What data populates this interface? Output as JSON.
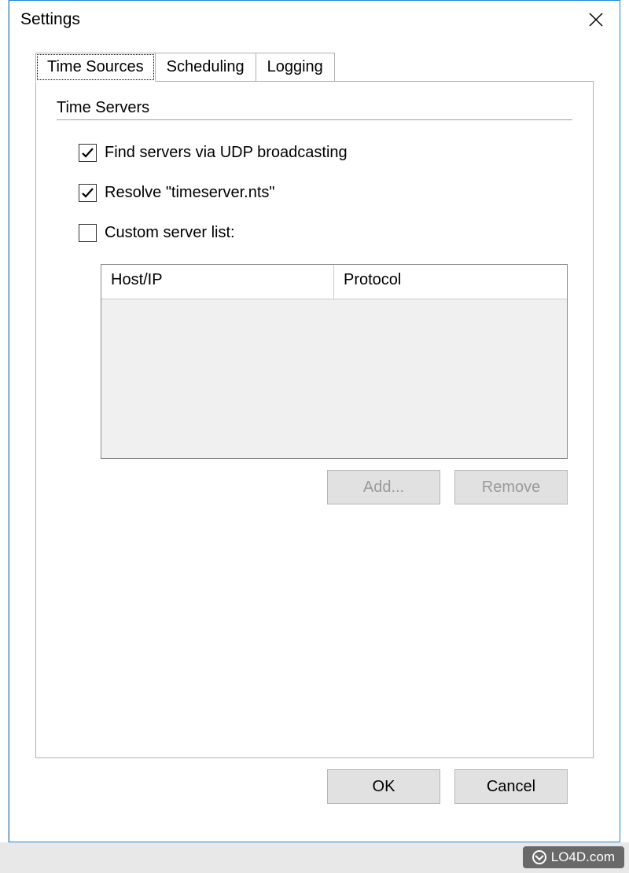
{
  "window": {
    "title": "Settings"
  },
  "tabs": [
    {
      "label": "Time Sources",
      "active": true
    },
    {
      "label": "Scheduling",
      "active": false
    },
    {
      "label": "Logging",
      "active": false
    }
  ],
  "section": {
    "title": "Time Servers"
  },
  "checkboxes": {
    "udp": {
      "label": "Find servers via UDP broadcasting",
      "checked": true
    },
    "resolve": {
      "label": "Resolve \"timeserver.nts\"",
      "checked": true
    },
    "custom": {
      "label": "Custom server list:",
      "checked": false
    }
  },
  "table": {
    "headers": {
      "host": "Host/IP",
      "protocol": "Protocol"
    },
    "rows": []
  },
  "buttons": {
    "add": "Add...",
    "remove": "Remove",
    "ok": "OK",
    "cancel": "Cancel"
  },
  "watermark": {
    "text": "LO4D.com"
  }
}
